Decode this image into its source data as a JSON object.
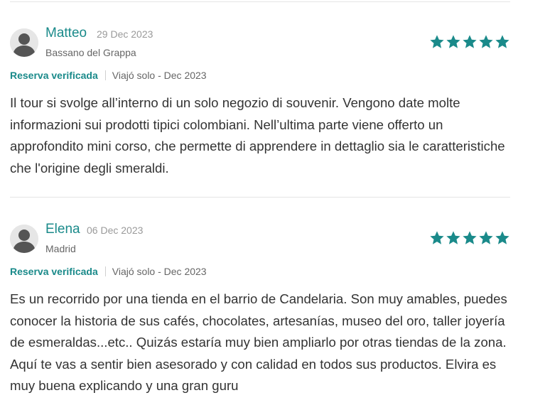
{
  "colors": {
    "accent": "#1a8a8a",
    "star": "#1a8a8a",
    "muted": "#9a9a9a",
    "text": "#333333",
    "divider": "#e5e5e5"
  },
  "reviews": [
    {
      "author": "Matteo",
      "date": "29 Dec 2023",
      "location": "Bassano del Grappa",
      "rating": 5,
      "verified_label": "Reserva verificada",
      "trip_info": "Viajó solo - Dec 2023",
      "text": "Il tour si svolge all’interno di un solo negozio di souvenir. Vengono date molte informazioni sui prodotti tipici colombiani. Nell’ultima parte viene offerto un approfondito mini corso, che permette di apprendere in dettaglio sia le caratteristiche che l'origine degli smeraldi."
    },
    {
      "author": "Elena",
      "date": "06 Dec 2023",
      "location": "Madrid",
      "rating": 5,
      "verified_label": "Reserva verificada",
      "trip_info": "Viajó solo - Dec 2023",
      "text": "Es un recorrido por una tienda en el barrio de Candelaria. Son muy amables, puedes conocer la historia de sus cafés, chocolates, artesanías, museo del oro, taller joyería de esmeraldas...etc.. Quizás estaría muy bien ampliarlo por otras tiendas de la zona. Aquí te vas a sentir bien asesorado y con calidad en todos sus productos. Elvira es muy buena explicando y una gran guru"
    }
  ]
}
